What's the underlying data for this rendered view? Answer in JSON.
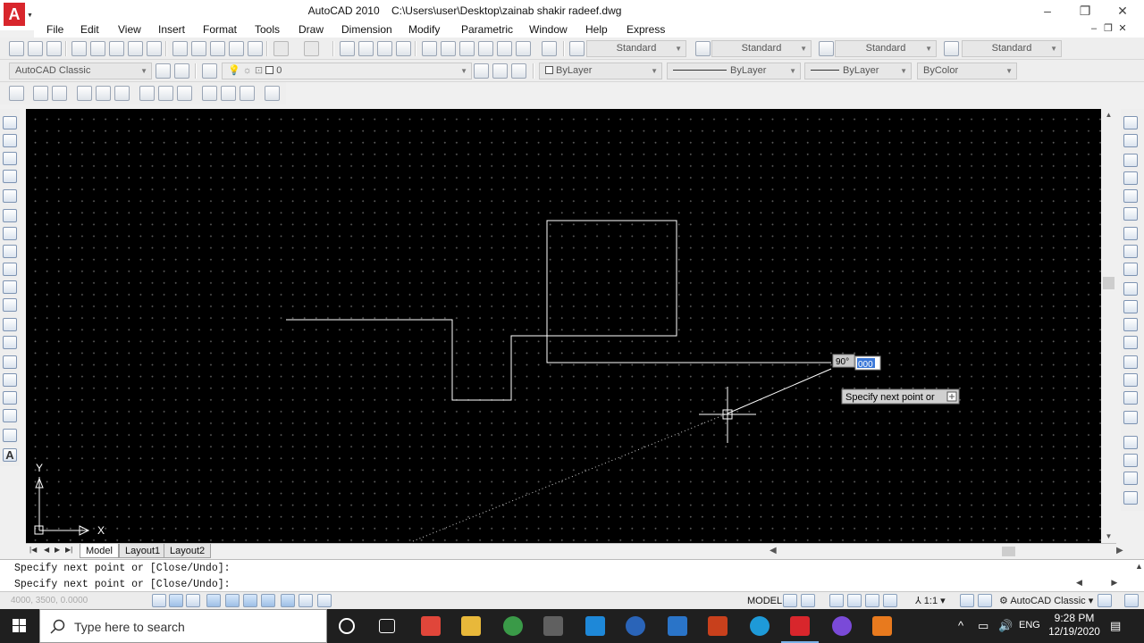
{
  "window": {
    "app_name": "AutoCAD 2010",
    "file_path": "C:\\Users\\user\\Desktop\\zainab shakir radeef.dwg",
    "minimize": "–",
    "restore": "❐",
    "close": "✕"
  },
  "menu": {
    "items": [
      "File",
      "Edit",
      "View",
      "Insert",
      "Format",
      "Tools",
      "Draw",
      "Dimension",
      "Modify",
      "Parametric",
      "Window",
      "Help",
      "Express"
    ],
    "doc_min": "–",
    "doc_restore": "❐",
    "doc_close": "✕"
  },
  "styles_toolbar": {
    "text_style": "Standard",
    "dim_style": "Standard",
    "table_style": "Standard",
    "multileader_style": "Standard"
  },
  "layers_toolbar": {
    "workspace": "AutoCAD Classic",
    "layer": "0",
    "color": "ByLayer",
    "linetype": "ByLayer",
    "lineweight": "ByLayer",
    "plotstyle": "ByColor"
  },
  "drawing": {
    "polar_angle": "90°",
    "length_input": "000",
    "tooltip": "Specify next point or",
    "ucs_x": "X",
    "ucs_y": "Y"
  },
  "tabs": {
    "items": [
      "Model",
      "Layout1",
      "Layout2"
    ],
    "active": "Model"
  },
  "command": {
    "history": "Specify next point or [Close/Undo]:",
    "prompt": "Specify next point or [Close/Undo]:"
  },
  "statusbar": {
    "coords": "4000, 3500, 0.0000",
    "model": "MODEL",
    "annotation_scale": "1:1",
    "workspace": "AutoCAD Classic"
  },
  "taskbar": {
    "search_placeholder": "Type here to search",
    "time": "9:28 PM",
    "date": "12/19/2020",
    "language": "ENG"
  },
  "colors": {
    "canvas": "#000000",
    "linework": "#ffffff",
    "autocad_red": "#d8262c",
    "taskbar": "#1f1f1f"
  }
}
